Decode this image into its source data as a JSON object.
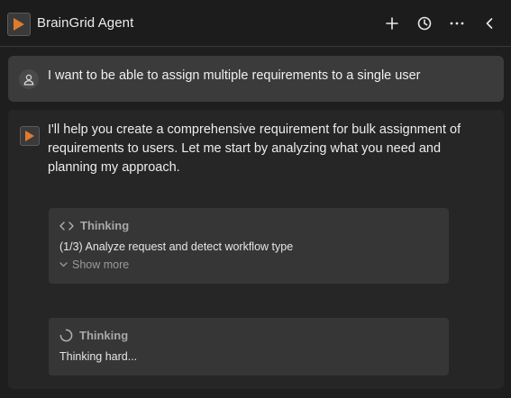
{
  "header": {
    "title": "BrainGrid Agent",
    "icons": [
      "logo-icon",
      "plus-icon",
      "history-icon",
      "more-icon",
      "chevron-left-icon"
    ],
    "accent": "#e07a2e"
  },
  "user_message": {
    "text": "I want to be able to assign multiple requirements to a single user"
  },
  "agent_message": {
    "text": "I'll help you create a comprehensive requirement for bulk assignment of requirements to users. Let me start by analyzing what you need and planning my approach."
  },
  "thinking_cards": [
    {
      "title": "Thinking",
      "body": "(1/3) Analyze request and detect workflow type",
      "show_more": "Show more"
    },
    {
      "title": "Thinking",
      "body": "Thinking hard..."
    }
  ]
}
